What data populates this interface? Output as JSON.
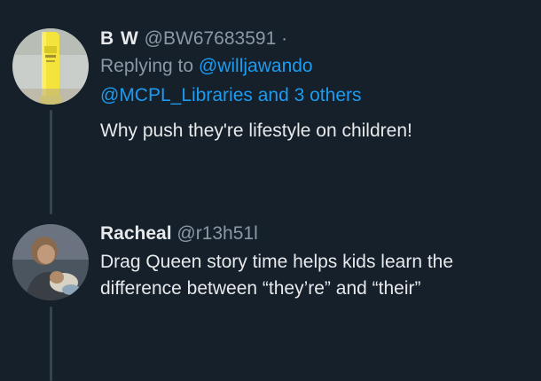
{
  "tweets": [
    {
      "display_name": "B W",
      "handle": "@BW67683591",
      "separator": "·",
      "replying_to_prefix": "Replying to",
      "reply_mention_primary": "@willjawando",
      "reply_mention_secondary": "@MCPL_Libraries",
      "reply_and_others": "and 3 others",
      "text": "Why push they're lifestyle on children!",
      "avatar": {
        "subject": "yellow-lotion-tube",
        "colors": [
          "#f3e33a",
          "#d6c926",
          "#c6cdb9"
        ]
      }
    },
    {
      "display_name": "Racheal",
      "handle": "@r13h51l",
      "text_line_1": "Drag Queen story time helps kids learn the",
      "text_line_2": "difference between “they’re” and “their”",
      "avatar": {
        "subject": "person-with-child",
        "colors": [
          "#6b7280",
          "#b08c6a",
          "#d8d2c4"
        ]
      }
    }
  ],
  "colors": {
    "background": "#15202b",
    "text_primary": "#e7e9ea",
    "text_secondary": "#8b98a5",
    "accent": "#1d9bf0",
    "thread_line": "#38444d"
  }
}
